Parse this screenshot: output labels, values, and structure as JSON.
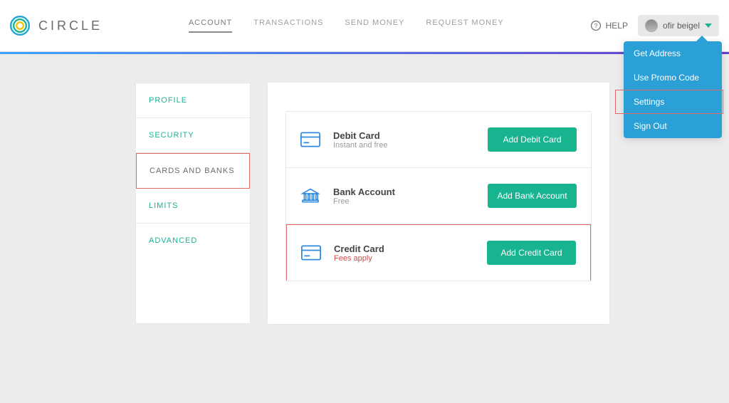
{
  "brand": {
    "name": "CIRCLE"
  },
  "nav": {
    "account": "ACCOUNT",
    "transactions": "TRANSACTIONS",
    "send": "SEND MONEY",
    "request": "REQUEST MONEY"
  },
  "help_label": "HELP",
  "user": {
    "name": "ofir beigel"
  },
  "dropdown": {
    "get_address": "Get Address",
    "promo": "Use Promo Code",
    "settings": "Settings",
    "sign_out": "Sign Out"
  },
  "sidebar": {
    "items": [
      {
        "label": "PROFILE"
      },
      {
        "label": "SECURITY"
      },
      {
        "label": "CARDS AND BANKS"
      },
      {
        "label": "LIMITS"
      },
      {
        "label": "ADVANCED"
      }
    ],
    "active_index": 2
  },
  "rows": {
    "debit": {
      "title": "Debit Card",
      "sub": "Instant and free",
      "button": "Add Debit Card"
    },
    "bank": {
      "title": "Bank Account",
      "sub": "Free",
      "button": "Add Bank Account"
    },
    "credit": {
      "title": "Credit Card",
      "sub": "Fees apply",
      "button": "Add Credit Card"
    }
  }
}
